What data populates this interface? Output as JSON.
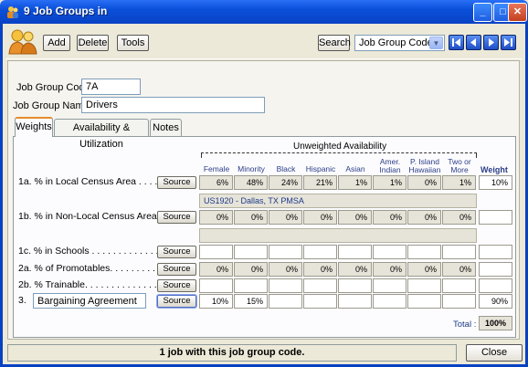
{
  "window": {
    "title": "9 Job Groups in"
  },
  "toolbar": {
    "add_label": "Add",
    "delete_label": "Delete",
    "tools_label": "Tools",
    "search_label": "Search",
    "search_field_value": "Job Group Code"
  },
  "form": {
    "code_label": "Job Group Code",
    "code_value": "7A",
    "name_label": "Job Group Name",
    "name_value": "Drivers"
  },
  "tabs": [
    {
      "label": "Weights"
    },
    {
      "label": "Availability & Utilization"
    },
    {
      "label": "Notes"
    }
  ],
  "grid": {
    "group_header": "Unweighted Availability",
    "columns": [
      [
        "Female"
      ],
      [
        "Minority"
      ],
      [
        "Black"
      ],
      [
        "Hispanic"
      ],
      [
        "Asian"
      ],
      [
        "Amer.",
        "Indian"
      ],
      [
        "P. Island",
        "Hawaiian"
      ],
      [
        "Two or",
        "More"
      ]
    ],
    "weight_header": "Weight",
    "source_label": "Source",
    "area_text": "US1920 - Dallas, TX PMSA",
    "rows": [
      {
        "label": "1a.  % in Local Census Area . . . . . . . .",
        "values": [
          "6%",
          "48%",
          "24%",
          "21%",
          "1%",
          "1%",
          "0%",
          "1%"
        ],
        "weight": "10%"
      },
      {
        "label": "1b.  % in Non-Local Census Area . . .",
        "values": [
          "0%",
          "0%",
          "0%",
          "0%",
          "0%",
          "0%",
          "0%",
          "0%"
        ],
        "weight": ""
      },
      {
        "label": "1c.  % in Schools . . . . . . . . . . . . . . . . .",
        "values": [
          "",
          "",
          "",
          "",
          "",
          "",
          "",
          ""
        ],
        "weight": ""
      },
      {
        "label": "2a.  % of Promotables. . . . . . . . . . . . . .",
        "values": [
          "0%",
          "0%",
          "0%",
          "0%",
          "0%",
          "0%",
          "0%",
          "0%"
        ],
        "weight": ""
      },
      {
        "label": "2b.  % Trainable. . . . . . . . . . . . . . . . . .",
        "values": [
          "",
          "",
          "",
          "",
          "",
          "",
          "",
          ""
        ],
        "weight": ""
      },
      {
        "label": "3.",
        "input_value": "Bargaining Agreement",
        "values": [
          "10%",
          "15%",
          "",
          "",
          "",
          "",
          "",
          ""
        ],
        "weight": "90%"
      }
    ],
    "total_label": "Total :",
    "total_value": "100%"
  },
  "status": {
    "message": "1 job with this job group code.",
    "close_label": "Close"
  }
}
